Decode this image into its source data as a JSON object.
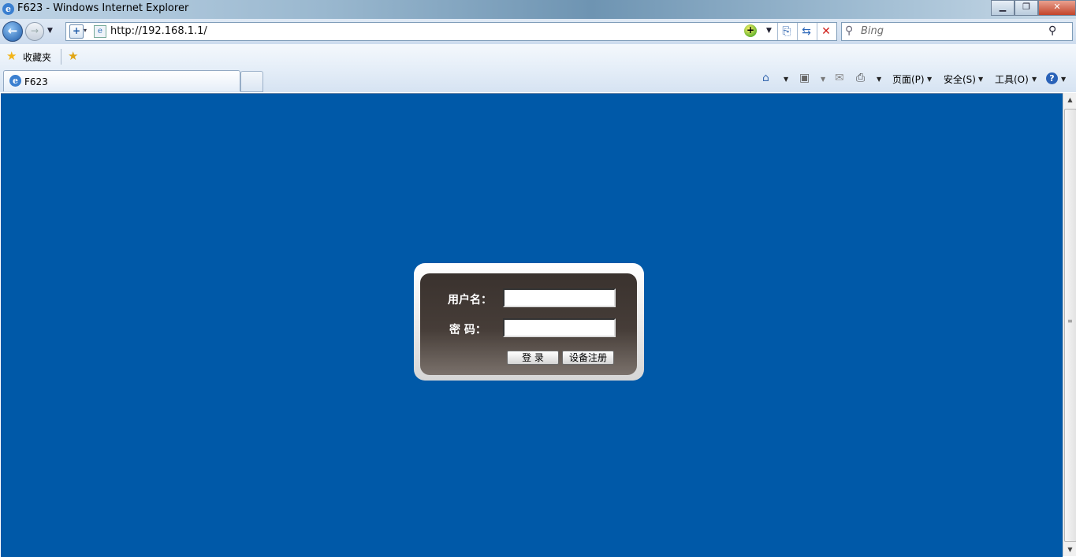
{
  "window": {
    "title": "F623 - Windows Internet Explorer",
    "controls": [
      "▁",
      "❐",
      "✕"
    ]
  },
  "address_bar": {
    "url": "http://192.168.1.1/"
  },
  "search": {
    "placeholder": "Bing"
  },
  "favorites": {
    "label": "收藏夹"
  },
  "tabs": [
    {
      "label": "F623"
    }
  ],
  "command_bar": {
    "page": "页面(P)",
    "safety": "安全(S)",
    "tools": "工具(O)"
  },
  "login": {
    "username_label": "用户名：",
    "password_label": "密  码：",
    "username_value": "",
    "password_value": "",
    "login_button": "登 录",
    "register_button": "设备注册"
  },
  "colors": {
    "page_background": "#0059a8",
    "login_panel": "#3d3531"
  },
  "icons": [
    "ie-logo-icon",
    "back-arrow-icon",
    "forward-arrow-icon",
    "compatibility-view-icon",
    "page-icon",
    "green-plus-icon",
    "compat-view-button-icon",
    "refresh-icon",
    "stop-icon",
    "search-icon",
    "favorites-star-icon",
    "add-favorite-icon",
    "home-icon",
    "rss-feed-icon",
    "mail-icon",
    "print-icon",
    "help-icon"
  ]
}
